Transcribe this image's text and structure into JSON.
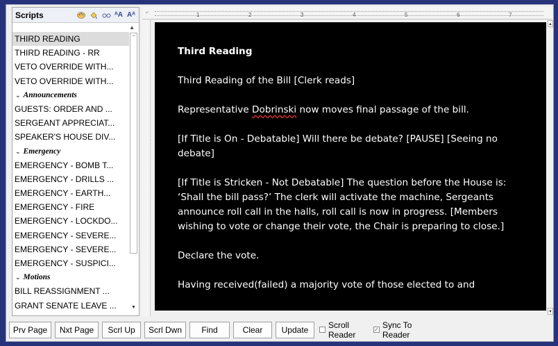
{
  "scripts_panel": {
    "title": "Scripts",
    "toolbar_icons": [
      "palette-icon",
      "paint-bucket-icon",
      "glasses-icon",
      "font-increase-icon",
      "font-decrease-icon"
    ],
    "items": [
      {
        "type": "item",
        "label": "THIRD READING",
        "selected": true
      },
      {
        "type": "item",
        "label": "THIRD READING - RR"
      },
      {
        "type": "item",
        "label": "VETO OVERRIDE WITH..."
      },
      {
        "type": "item",
        "label": "VETO OVERRIDE WITH..."
      },
      {
        "type": "group",
        "label": "Announcements"
      },
      {
        "type": "item",
        "label": "GUESTS: ORDER AND ..."
      },
      {
        "type": "item",
        "label": "SERGEANT APPRECIAT..."
      },
      {
        "type": "item",
        "label": "SPEAKER'S HOUSE DIV..."
      },
      {
        "type": "group",
        "label": "Emergency"
      },
      {
        "type": "item",
        "label": "EMERGENCY - BOMB T..."
      },
      {
        "type": "item",
        "label": "EMERGENCY - DRILLS ..."
      },
      {
        "type": "item",
        "label": "EMERGENCY - EARTH..."
      },
      {
        "type": "item",
        "label": "EMERGENCY - FIRE"
      },
      {
        "type": "item",
        "label": "EMERGENCY - LOCKDO..."
      },
      {
        "type": "item",
        "label": "EMERGENCY - SEVERE..."
      },
      {
        "type": "item",
        "label": "EMERGENCY - SEVERE..."
      },
      {
        "type": "item",
        "label": "EMERGENCY - SUSPICI..."
      },
      {
        "type": "group",
        "label": "Motions"
      },
      {
        "type": "item",
        "label": "BILL REASSIGNMENT ..."
      },
      {
        "type": "item",
        "label": "GRANT SENATE LEAVE ..."
      }
    ]
  },
  "ruler": {
    "numbers": [
      "1",
      "2",
      "3",
      "4",
      "5",
      "6",
      "7"
    ]
  },
  "document": {
    "heading": "Third Reading",
    "p1": "Third Reading of the Bill [Clerk reads]",
    "p2_before": "Representative ",
    "p2_name": "Dobrinski",
    "p2_after": " now moves final passage of the bill.",
    "p3": "[If Title is On - Debatable] Will there be debate? [PAUSE]  [Seeing no debate]",
    "p4": "[If Title is Stricken - Not Debatable] The question before the House is: ‘Shall the bill pass?’  The clerk will activate the machine, Sergeants announce roll call in the halls, roll call is now in progress. [Members wishing to vote or change their vote, the Chair is preparing to close.]",
    "p5": "Declare the vote.",
    "p6": "Having received(failed) a majority vote of those elected to and"
  },
  "toolbar": {
    "prev_page": "Prv Page",
    "next_page": "Nxt Page",
    "scroll_up": "Scrl Up",
    "scroll_down": "Scrl Dwn",
    "find": "Find",
    "clear": "Clear",
    "update": "Update",
    "scroll_reader": "Scroll Reader",
    "sync_to_reader": "Sync To Reader",
    "scroll_reader_checked": false,
    "sync_to_reader_checked": true
  }
}
